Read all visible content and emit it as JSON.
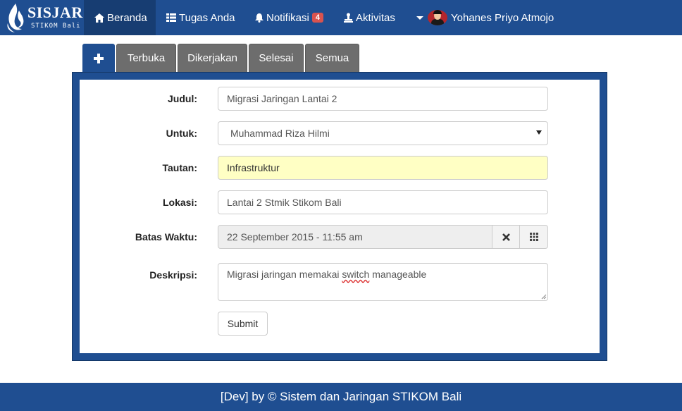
{
  "brand": {
    "title": "SISJAR",
    "subtitle": "STIKOM Bali"
  },
  "nav": {
    "items": [
      {
        "label": "Beranda",
        "icon": "home-icon",
        "active": true
      },
      {
        "label": "Tugas Anda",
        "icon": "table-icon"
      },
      {
        "label": "Notifikasi",
        "icon": "bell-icon",
        "badge": "4"
      },
      {
        "label": "Aktivitas",
        "icon": "stamp-icon"
      }
    ],
    "user": {
      "name": "Yohanes Priyo Atmojo"
    }
  },
  "tabs": [
    {
      "label": "+",
      "icon": "plus-icon",
      "active": true
    },
    {
      "label": "Terbuka"
    },
    {
      "label": "Dikerjakan"
    },
    {
      "label": "Selesai"
    },
    {
      "label": "Semua"
    }
  ],
  "form": {
    "judul": {
      "label": "Judul:",
      "value": "Migrasi Jaringan Lantai 2"
    },
    "untuk": {
      "label": "Untuk:",
      "value": "Muhammad Riza Hilmi"
    },
    "tautan": {
      "label": "Tautan:",
      "value": "Infrastruktur"
    },
    "lokasi": {
      "label": "Lokasi:",
      "value": "Lantai 2 Stmik Stikom Bali"
    },
    "batas_waktu": {
      "label": "Batas Waktu:",
      "value": "22 September 2015 - 11:55 am"
    },
    "deskripsi": {
      "label": "Deskripsi:",
      "value_before": "Migrasi jaringan memakai ",
      "value_marked": "switch",
      "value_after": " manageable"
    },
    "submit_label": "Submit"
  },
  "footer": {
    "text": "[Dev] by © Sistem dan Jaringan STIKOM Bali"
  },
  "colors": {
    "primary": "#1f4e91",
    "nav_active": "#173d72",
    "tab_inactive": "#6d6d6d",
    "badge": "#d9534f",
    "highlight": "#ffffc4"
  }
}
